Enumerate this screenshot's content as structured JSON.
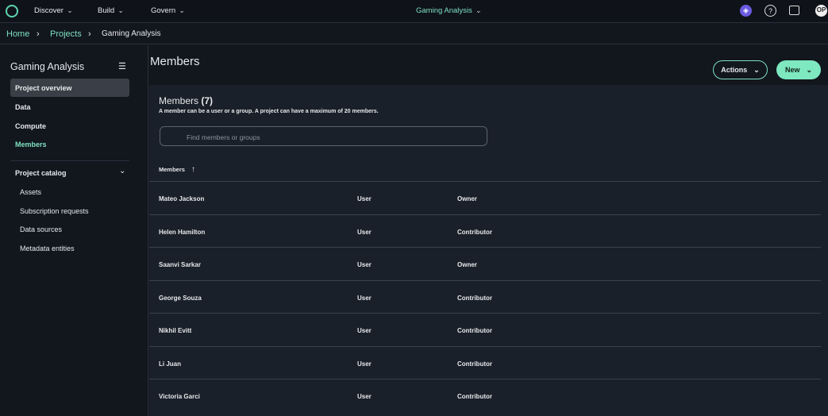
{
  "topnav": {
    "items": [
      "Discover",
      "Build",
      "Govern"
    ],
    "project": "Gaming Analysis",
    "avatar": "OP"
  },
  "breadcrumb": [
    "Home",
    "Projects",
    "Gaming Analysis"
  ],
  "sidebar": {
    "title": "Gaming Analysis",
    "items": [
      "Project overview",
      "Data",
      "Compute",
      "Members"
    ],
    "catalog": "Project catalog",
    "catalog_items": [
      "Assets",
      "Subscription requests",
      "Data sources",
      "Metadata entities"
    ]
  },
  "main": {
    "title": "Members",
    "actions": "Actions",
    "new": "New",
    "panel_title": "Members",
    "count": "(7)",
    "description": "A member can be a user or a group. A project can have a maximum of 20 members.",
    "search_placeholder": "Find members or groups",
    "column": "Members",
    "rows": [
      [
        "Mateo Jackson",
        "User",
        "Owner"
      ],
      [
        "Helen Hamilton",
        "User",
        "Contributor"
      ],
      [
        "Saanvi Sarkar",
        "User",
        "Owner"
      ],
      [
        "George Souza",
        "User",
        "Contributor"
      ],
      [
        "Nikhil Evitt",
        "User",
        "Contributor"
      ],
      [
        "Li Juan",
        "User",
        "Contributor"
      ],
      [
        "Victoria Garci",
        "User",
        "Contributor"
      ]
    ]
  }
}
